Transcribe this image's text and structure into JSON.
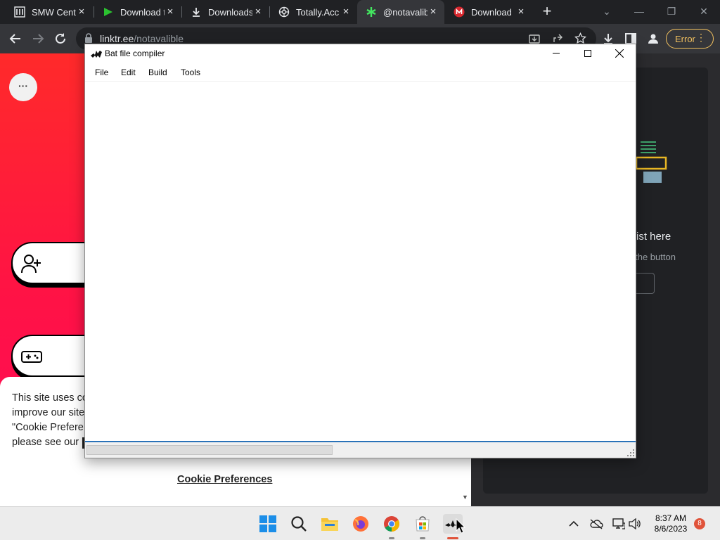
{
  "browser": {
    "tabs": [
      {
        "title": "SMW Centr",
        "icon": "smw-central-icon",
        "active": false
      },
      {
        "title": "Download t",
        "icon": "play-arrow-icon",
        "active": false
      },
      {
        "title": "Downloads",
        "icon": "download-icon",
        "active": false
      },
      {
        "title": "Totally.Acc",
        "icon": "gear-globe-icon",
        "active": false
      },
      {
        "title": "@notavalib",
        "icon": "linktree-icon",
        "active": true
      },
      {
        "title": "Download",
        "icon": "mega-icon",
        "active": false
      }
    ],
    "url_host": "linktr.ee",
    "url_path": "/notavalible",
    "error_label": "Error",
    "colors": {
      "frame": "#202124",
      "toolbar": "#35363a",
      "error": "#f2c15f"
    }
  },
  "page": {
    "more_label": "···",
    "cookie_text": "This site uses co\nimprove our site\n\"Cookie Prefere\nplease see our",
    "cookie_pref_label": "Cookie Preferences",
    "colors": {
      "gradient_top": "#ff2a2a",
      "gradient_bottom": "#ff0a5a"
    }
  },
  "side_panel": {
    "title_partial": "ist here",
    "subtitle_partial": "k the button"
  },
  "app": {
    "title": "Bat file compiler",
    "menu": [
      "File",
      "Edit",
      "Build",
      "Tools"
    ],
    "editor_text": ""
  },
  "taskbar": {
    "time": "8:37 AM",
    "date": "8/6/2023",
    "notification_count": "8",
    "apps": [
      "windows-start-icon",
      "search-icon",
      "file-explorer-icon",
      "firefox-icon",
      "chrome-icon",
      "microsoft-store-icon",
      "bat-compiler-icon"
    ]
  }
}
